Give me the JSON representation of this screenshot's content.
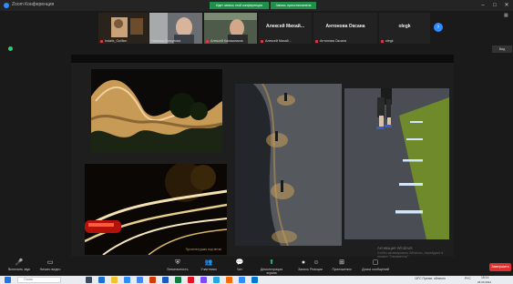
{
  "window": {
    "title": "Zoom Конференция"
  },
  "recording": {
    "banner": "Идет запись этой конференции",
    "banner2": "Запись приостановлена"
  },
  "participants": [
    {
      "name": "Indalix_Guillion",
      "type": "video"
    },
    {
      "name": "Наталья Лоскутова",
      "type": "video"
    },
    {
      "name": "Алексей Калашников",
      "type": "video"
    },
    {
      "name": "Алексей Михай...",
      "display": "Алексей Михай...",
      "type": "name"
    },
    {
      "name": "Антонова Оксана",
      "display": "Антонова Оксана",
      "type": "name"
    },
    {
      "name": "olegk",
      "display": "olegk",
      "type": "name"
    }
  ],
  "strip_next": "›",
  "view_button": "Вид",
  "watermark": {
    "line1": "Активация Windows",
    "line2": "Чтобы активировать Windows, перейдите в раздел \"Параметры\"."
  },
  "photo_caption": "Архитектурная подсветка",
  "toolbar": [
    {
      "label": "Включить звук",
      "icon": "mic-icon",
      "glyph": "🎤"
    },
    {
      "label": "Начать видео",
      "icon": "video-icon",
      "glyph": "▭"
    },
    {
      "label": "Безопасность",
      "icon": "shield-icon",
      "glyph": "⛨"
    },
    {
      "label": "Участники",
      "icon": "participants-icon",
      "glyph": "👥"
    },
    {
      "label": "Чат",
      "icon": "chat-icon",
      "glyph": "💬"
    },
    {
      "label": "Демонстрация экрана",
      "icon": "share-screen-icon",
      "glyph": "⬆"
    },
    {
      "label": "Запись",
      "icon": "record-icon",
      "glyph": "●"
    },
    {
      "label": "Реакции",
      "icon": "reactions-icon",
      "glyph": "☺"
    },
    {
      "label": "Приложения",
      "icon": "apps-icon",
      "glyph": "⊞"
    },
    {
      "label": "Доска сообщений",
      "icon": "whiteboard-icon",
      "glyph": "▢"
    }
  ],
  "end_button": "Завершить",
  "taskbar": {
    "search_placeholder": "Поиск",
    "tray_weather": "18°C Преим. облачно",
    "tray_lang": "РУС",
    "time": "18:14",
    "date": "28.09.2022"
  },
  "colors": {
    "accent": "#2d8cff",
    "end": "#e02f2f",
    "record": "#1f8f4a"
  }
}
